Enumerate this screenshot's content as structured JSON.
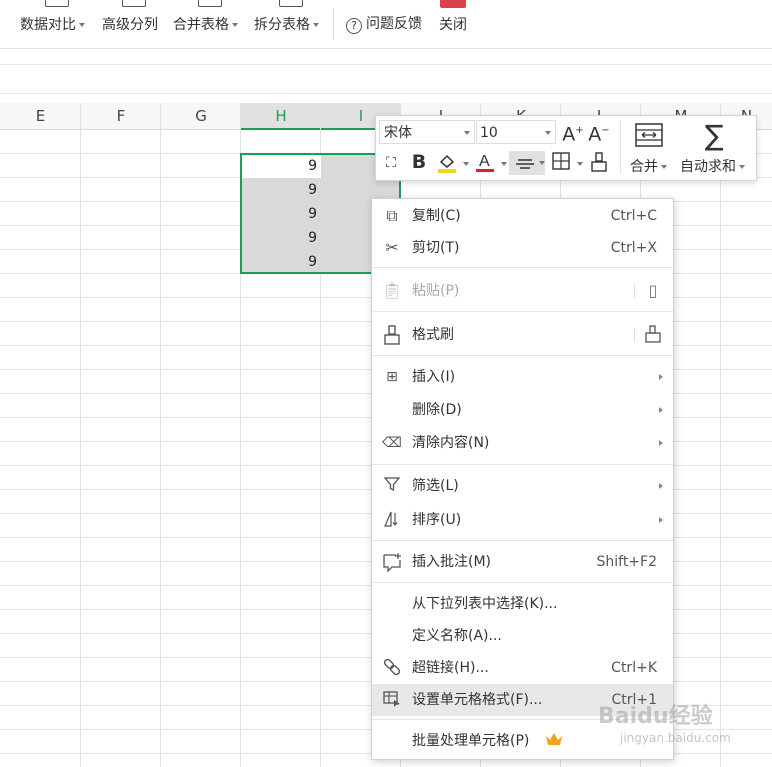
{
  "ribbon": {
    "buttons": [
      "数据对比",
      "高级分列",
      "合并表格",
      "拆分表格"
    ],
    "help_label": "问题反馈",
    "close_label": "关闭"
  },
  "columns": [
    "E",
    "F",
    "G",
    "H",
    "I",
    "J",
    "K",
    "L",
    "M",
    "N"
  ],
  "selected_cells": {
    "column": "H",
    "values": [
      "9",
      "9",
      "9",
      "9",
      "9"
    ]
  },
  "mini_toolbar": {
    "font_name": "宋体",
    "font_size": "10",
    "grow_font": "A⁺",
    "shrink_font": "A⁻",
    "merge_label": "合并",
    "autosum_label": "自动求和",
    "font_color": "#e02020",
    "fill_color": "#f5d31f"
  },
  "context_menu": {
    "items": [
      {
        "label": "复制(C)",
        "shortcut": "Ctrl+C",
        "icon": "copy-icon"
      },
      {
        "label": "剪切(T)",
        "shortcut": "Ctrl+X",
        "icon": "scissors-icon"
      },
      {
        "label": "粘贴(P)",
        "icon": "paste-icon",
        "disabled": true
      },
      {
        "label": "格式刷",
        "icon": "format-brush-icon"
      },
      {
        "label": "插入(I)",
        "icon": "insert-icon",
        "submenu": true
      },
      {
        "label": "删除(D)",
        "submenu": true
      },
      {
        "label": "清除内容(N)",
        "icon": "eraser-icon",
        "submenu": true
      },
      {
        "label": "筛选(L)",
        "icon": "filter-icon",
        "submenu": true
      },
      {
        "label": "排序(U)",
        "icon": "sort-icon",
        "submenu": true
      },
      {
        "label": "插入批注(M)",
        "shortcut": "Shift+F2",
        "icon": "comment-icon"
      },
      {
        "label": "从下拉列表中选择(K)..."
      },
      {
        "label": "定义名称(A)..."
      },
      {
        "label": "超链接(H)...",
        "shortcut": "Ctrl+K",
        "icon": "link-icon"
      },
      {
        "label": "设置单元格格式(F)...",
        "shortcut": "Ctrl+1",
        "icon": "format-cells-icon",
        "highlighted": true
      },
      {
        "label": "批量处理单元格(P)",
        "icon": "crown-icon"
      }
    ]
  },
  "watermark": {
    "brand": "Baidu经验",
    "url": "jingyan.baidu.com"
  },
  "colors": {
    "accent": "#1f9c58",
    "selection": "#d9d9d9"
  }
}
